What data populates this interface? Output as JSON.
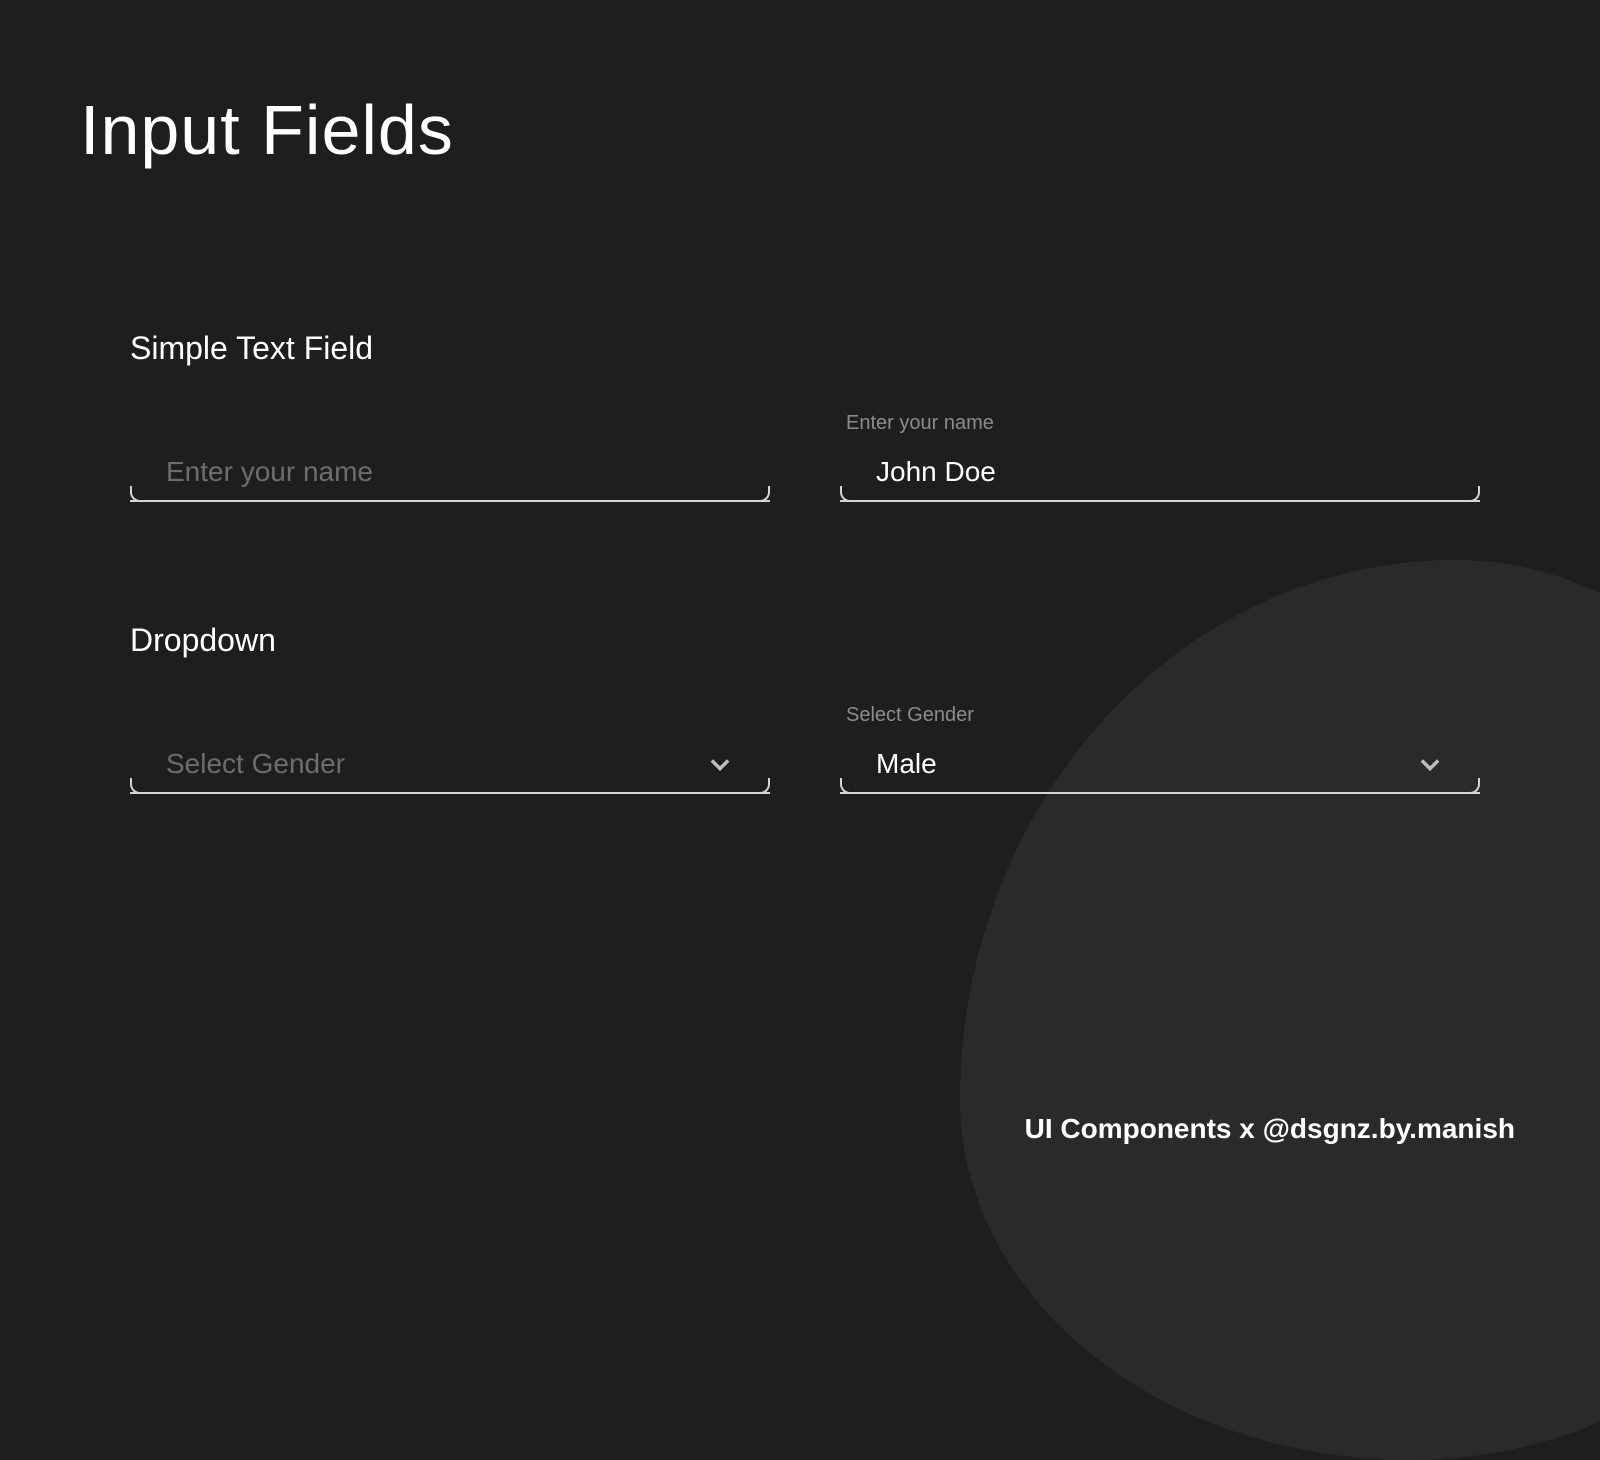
{
  "page": {
    "title": "Input Fields"
  },
  "sections": {
    "text": {
      "heading": "Simple Text Field",
      "empty": {
        "placeholder": "Enter your name",
        "value": ""
      },
      "filled": {
        "float_label": "Enter your name",
        "value": "John Doe"
      }
    },
    "dropdown": {
      "heading": "Dropdown",
      "empty": {
        "placeholder": "Select Gender"
      },
      "filled": {
        "float_label": "Select Gender",
        "value": "Male"
      }
    }
  },
  "footer": {
    "credit": "UI Components x @dsgnz.by.manish"
  },
  "colors": {
    "bg": "#1f1d1d",
    "blob": "#2b2929",
    "line": "#d5d5d5",
    "placeholder": "#6e6c6c",
    "label": "#8d8b8b",
    "text": "#ffffff"
  }
}
